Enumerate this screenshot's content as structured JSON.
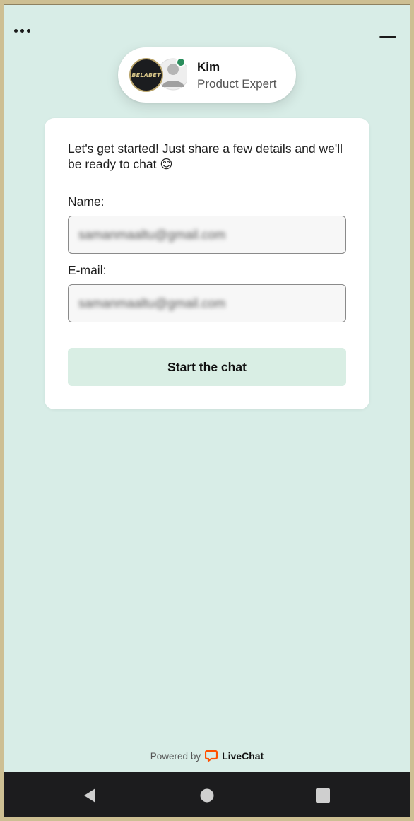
{
  "header": {
    "menu_icon": "more-dots-icon",
    "minimize_icon": "minimize-icon"
  },
  "agent": {
    "logo_text": "BELABET",
    "name": "Kim",
    "role": "Product Expert",
    "status_color": "#2a8d5c"
  },
  "form": {
    "intro": "Let's get started! Just share a few details and we'll be ready to chat 😊",
    "name_label": "Name:",
    "name_value": "samanmaaltu@gmail.com",
    "email_label": "E-mail:",
    "email_value": "samanmaaltu@gmail.com",
    "submit_label": "Start the chat"
  },
  "footer": {
    "powered_by": "Powered by",
    "brand": "LiveChat",
    "brand_color": "#ff5100"
  },
  "nav": {
    "back_icon": "back-triangle-icon",
    "home_icon": "home-circle-icon",
    "recents_icon": "recents-square-icon"
  },
  "colors": {
    "background": "#d8ede7",
    "button": "#d9eee4"
  }
}
